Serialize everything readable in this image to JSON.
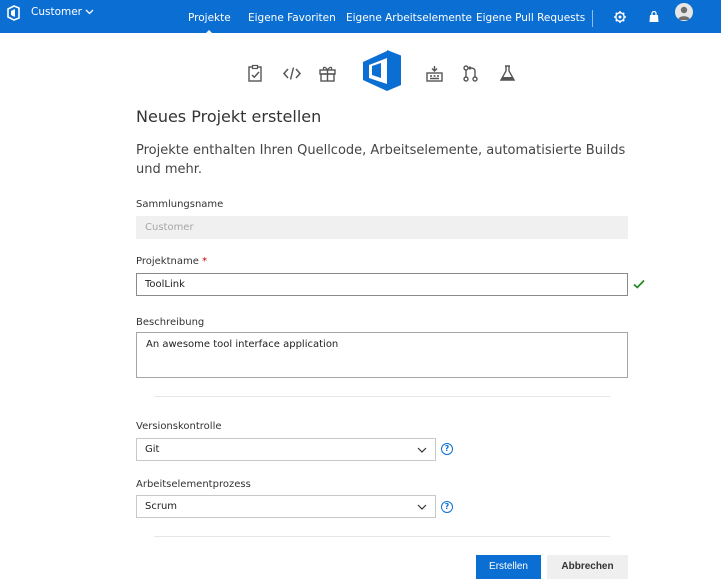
{
  "header": {
    "account": "Customer",
    "nav": [
      "Projekte",
      "Eigene Favoriten",
      "Eigene Arbeitselemente",
      "Eigene Pull Requests"
    ],
    "active_nav": "Projekte",
    "icons": [
      "vsts-logo-icon",
      "chevron-down-icon",
      "gear-icon",
      "bag-icon",
      "user-avatar-icon"
    ]
  },
  "strip_icons": [
    "clipboard-check-icon",
    "code-icon",
    "gift-icon",
    "vsts-logo-icon",
    "build-icon",
    "pull-request-icon",
    "flask-icon"
  ],
  "form": {
    "title": "Neues Projekt erstellen",
    "subtitle": "Projekte enthalten Ihren Quellcode, Arbeitselemente, automatisierte Builds und mehr.",
    "collection_label": "Sammlungsname",
    "collection_value": "Customer",
    "project_label": "Projektname",
    "required_mark": "*",
    "project_value": "ToolLink",
    "description_label": "Beschreibung",
    "description_value": "An awesome tool interface application",
    "vc_label": "Versionskontrolle",
    "vc_value": "Git",
    "process_label": "Arbeitselementprozess",
    "process_value": "Scrum",
    "help_glyph": "?",
    "create_button": "Erstellen",
    "cancel_button": "Abbrechen"
  },
  "colors": {
    "accent": "#0b6ed3",
    "valid": "#1e8a1e",
    "required": "#cc0000"
  }
}
